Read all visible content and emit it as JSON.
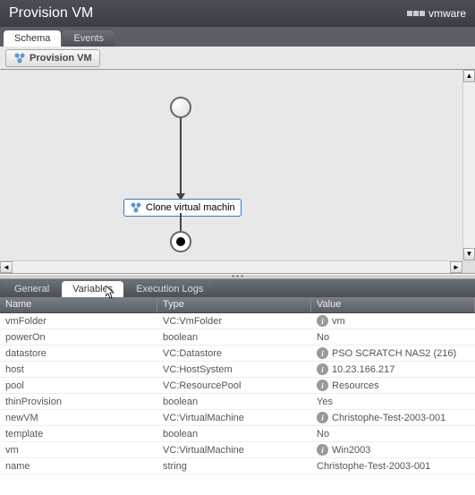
{
  "header": {
    "title": "Provision VM",
    "brand": "vmware"
  },
  "topTabs": {
    "schema": "Schema",
    "events": "Events"
  },
  "toolbar": {
    "workflow_btn": "Provision VM"
  },
  "workflow": {
    "action_label": "Clone virtual machin"
  },
  "bottomTabs": {
    "general": "General",
    "variables": "Variables",
    "logs": "Execution Logs"
  },
  "columns": {
    "name": "Name",
    "type": "Type",
    "value": "Value"
  },
  "rows": [
    {
      "name": "vmFolder",
      "type": "VC:VmFolder",
      "value": "vm",
      "icon": true
    },
    {
      "name": "powerOn",
      "type": "boolean",
      "value": "No",
      "icon": false
    },
    {
      "name": "datastore",
      "type": "VC:Datastore",
      "value": "PSO SCRATCH NAS2 (216)",
      "icon": true
    },
    {
      "name": "host",
      "type": "VC:HostSystem",
      "value": "10.23.166.217",
      "icon": true
    },
    {
      "name": "pool",
      "type": "VC:ResourcePool",
      "value": "Resources",
      "icon": true
    },
    {
      "name": "thinProvision",
      "type": "boolean",
      "value": "Yes",
      "icon": false
    },
    {
      "name": "newVM",
      "type": "VC:VirtualMachine",
      "value": "Christophe-Test-2003-001",
      "icon": true
    },
    {
      "name": "template",
      "type": "boolean",
      "value": "No",
      "icon": false
    },
    {
      "name": "vm",
      "type": "VC:VirtualMachine",
      "value": "Win2003",
      "icon": true
    },
    {
      "name": "name",
      "type": "string",
      "value": "Christophe-Test-2003-001",
      "icon": false
    }
  ]
}
